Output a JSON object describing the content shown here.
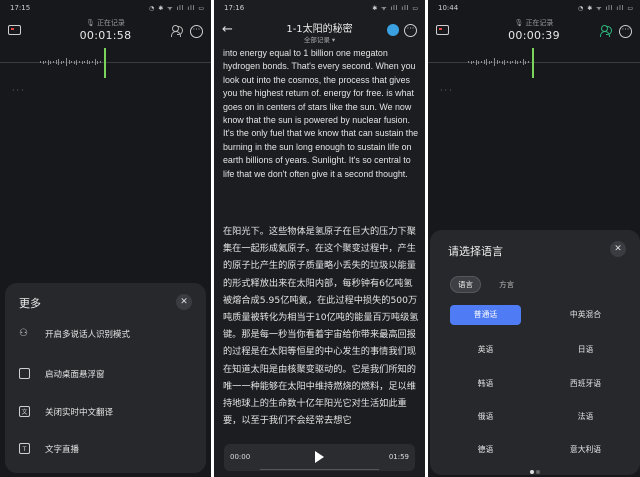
{
  "screen1": {
    "time": "17:15",
    "status_icons": "◔ ✱ ᯤ ıll ıll ▭",
    "rec_status": "正在记录",
    "rec_time": "00:01:58",
    "more_sheet": {
      "title": "更多",
      "items": [
        {
          "label": "开启多说话人识别模式",
          "icon": "people-icon"
        },
        {
          "label": "启动桌面悬浮窗",
          "icon": "window-icon"
        },
        {
          "label": "关闭实时中文翻译",
          "icon": "translate-icon"
        },
        {
          "label": "文字直播",
          "icon": "live-icon"
        }
      ]
    }
  },
  "screen2": {
    "time": "17:16",
    "status_icons": "✱ ᯤ ıll ıll ▭",
    "title": "1-1太阳的秘密",
    "subtitle": "全部记录 ▾",
    "en_text": "into energy equal to 1 billion one megaton hydrogen bonds. That's every second. When you look out into the cosmos, the process that gives you the highest return of.  energy for free. is what goes on in centers of stars like the sun. We now know that the sun is powered by nuclear fusion. It's the only fuel that we know that can sustain the burning in the sun long enough to sustain life on earth billions of years. Sunlight. It's so central to life that we don't often give it a second thought.",
    "zh_text": "在阳光下。这些物体是氢原子在巨大的压力下聚集在一起形成氦原子。在这个聚变过程中，产生的原子比产生的原子质量略小丢失的垃圾以能量的形式释放出来在太阳内部，每秒钟有6亿吨氢被熔合成5.95亿吨氦，在此过程中损失的500万吨质量被转化为相当于10亿吨的能量百万吨级氢键。那是每一秒当你看着宇宙给你带来最高回报的过程是在太阳等恒星的中心发生的事情我们现在知道太阳是由核聚变驱动的。它是我们所知的唯一一种能够在太阳中维持燃烧的燃料，足以维持地球上的生命数十亿年阳光它对生活如此重要，以至于我们不会经常去想它",
    "player": {
      "current": "00:00",
      "total": "01:59"
    }
  },
  "screen3": {
    "time": "10:44",
    "status_icons": "◔ ✱ ᯤ ıll ıll ▭",
    "rec_status": "正在记录",
    "rec_time": "00:00:39",
    "lang_sheet": {
      "title": "请选择语言",
      "tabs": [
        "语言",
        "方言"
      ],
      "options": [
        "普通话",
        "中英混合",
        "英语",
        "日语",
        "韩语",
        "西班牙语",
        "俄语",
        "法语",
        "德语",
        "意大利语"
      ],
      "selected": "普通话"
    }
  },
  "colors": {
    "accent": "#4f7cf5",
    "recording_green": "#7ad35a",
    "background": "#16181c"
  }
}
